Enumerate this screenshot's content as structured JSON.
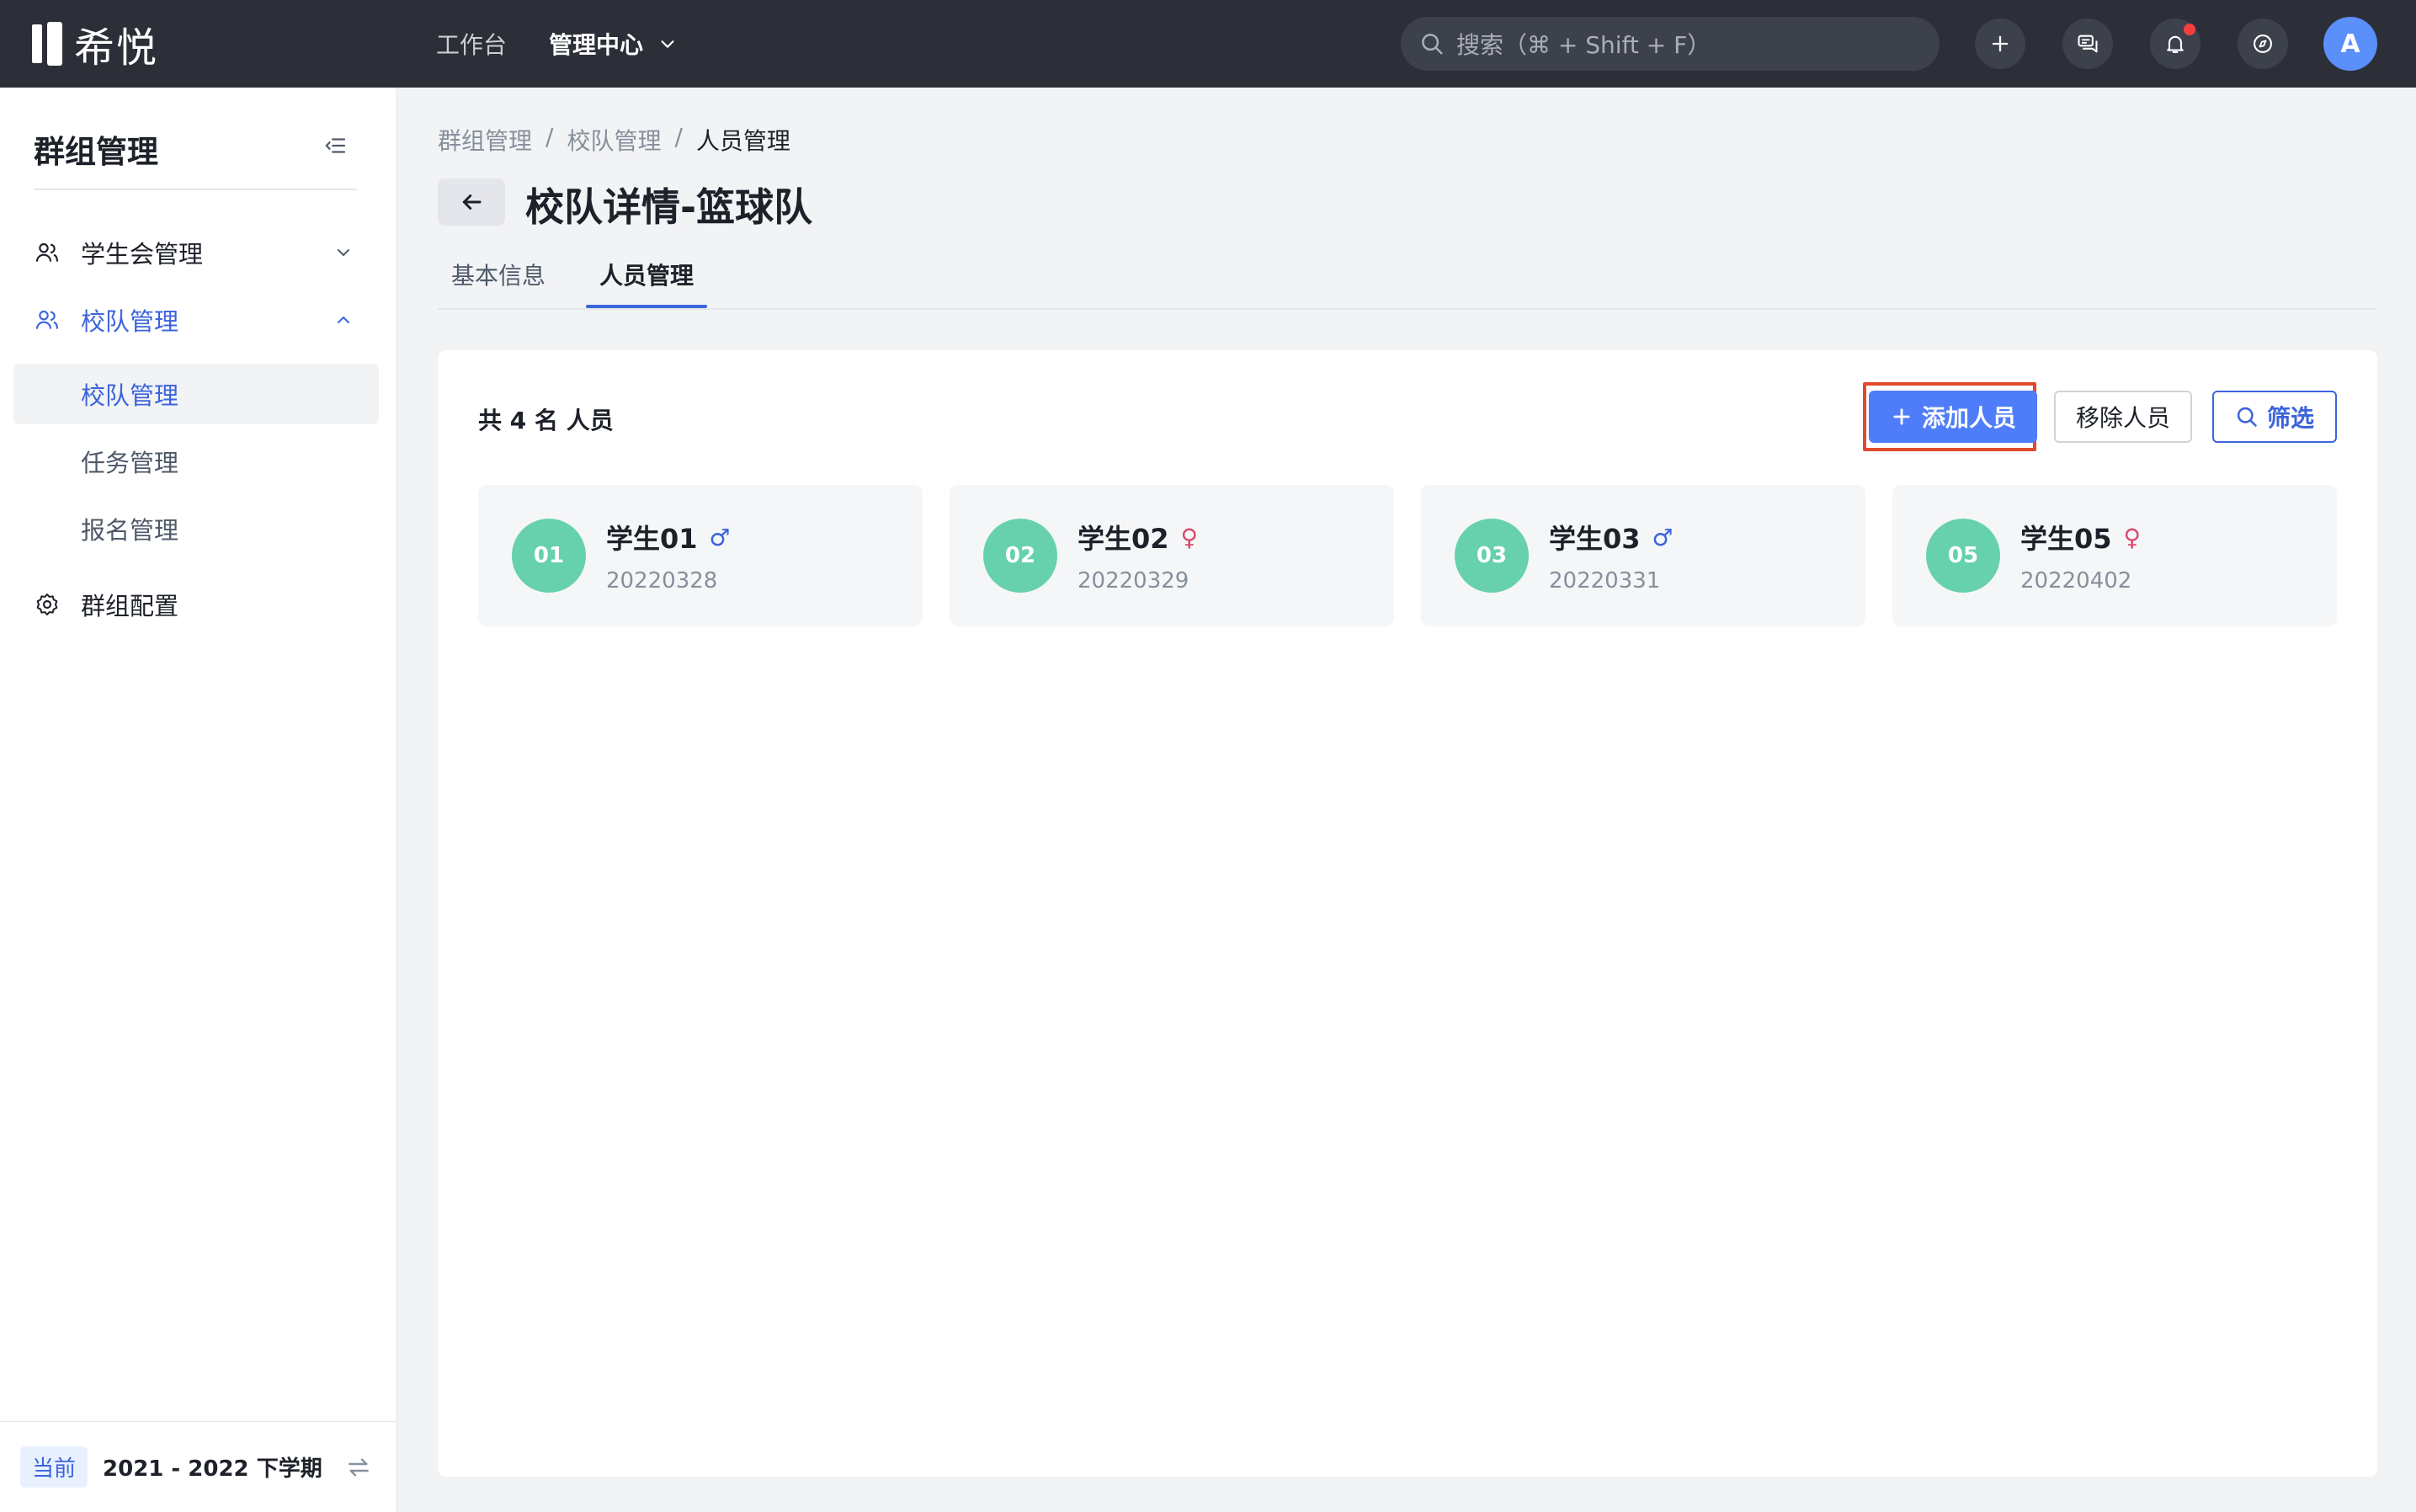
{
  "app": {
    "name": "希悦"
  },
  "topnav": {
    "workbench": "工作台",
    "admin_center": "管理中心"
  },
  "search": {
    "placeholder": "搜索（⌘ + Shift + F）"
  },
  "user": {
    "initial": "A"
  },
  "sidebar": {
    "title": "群组管理",
    "items": [
      {
        "label": "学生会管理",
        "icon": "users-icon",
        "state": "collapsed"
      },
      {
        "label": "校队管理",
        "icon": "users-icon",
        "state": "expanded"
      }
    ],
    "sub_items": [
      {
        "label": "校队管理",
        "active": true
      },
      {
        "label": "任务管理",
        "active": false
      },
      {
        "label": "报名管理",
        "active": false
      }
    ],
    "config": {
      "label": "群组配置",
      "icon": "gear-icon"
    },
    "footer": {
      "badge": "当前",
      "term": "2021 - 2022 下学期"
    }
  },
  "breadcrumb": [
    "群组管理",
    "校队管理",
    "人员管理"
  ],
  "breadcrumb_sep": "/",
  "page": {
    "title": "校队详情-篮球队"
  },
  "tabs": [
    {
      "label": "基本信息",
      "active": false
    },
    {
      "label": "人员管理",
      "active": true
    }
  ],
  "members": {
    "count_label": "共 4 名 人员",
    "actions": {
      "add": "添加人员",
      "remove": "移除人员",
      "filter": "筛选"
    },
    "list": [
      {
        "badge": "01",
        "name": "学生01",
        "gender": "♂",
        "gender_type": "male",
        "id": "20220328"
      },
      {
        "badge": "02",
        "name": "学生02",
        "gender": "♀",
        "gender_type": "female",
        "id": "20220329"
      },
      {
        "badge": "03",
        "name": "学生03",
        "gender": "♂",
        "gender_type": "male",
        "id": "20220331"
      },
      {
        "badge": "05",
        "name": "学生05",
        "gender": "♀",
        "gender_type": "female",
        "id": "20220402"
      }
    ]
  },
  "colors": {
    "accent": "#3c64dc",
    "primary_button": "#4f7df9",
    "avatar_green": "#67d1ad",
    "highlight_border": "#e24a2b",
    "topbar": "#2c2f38"
  }
}
